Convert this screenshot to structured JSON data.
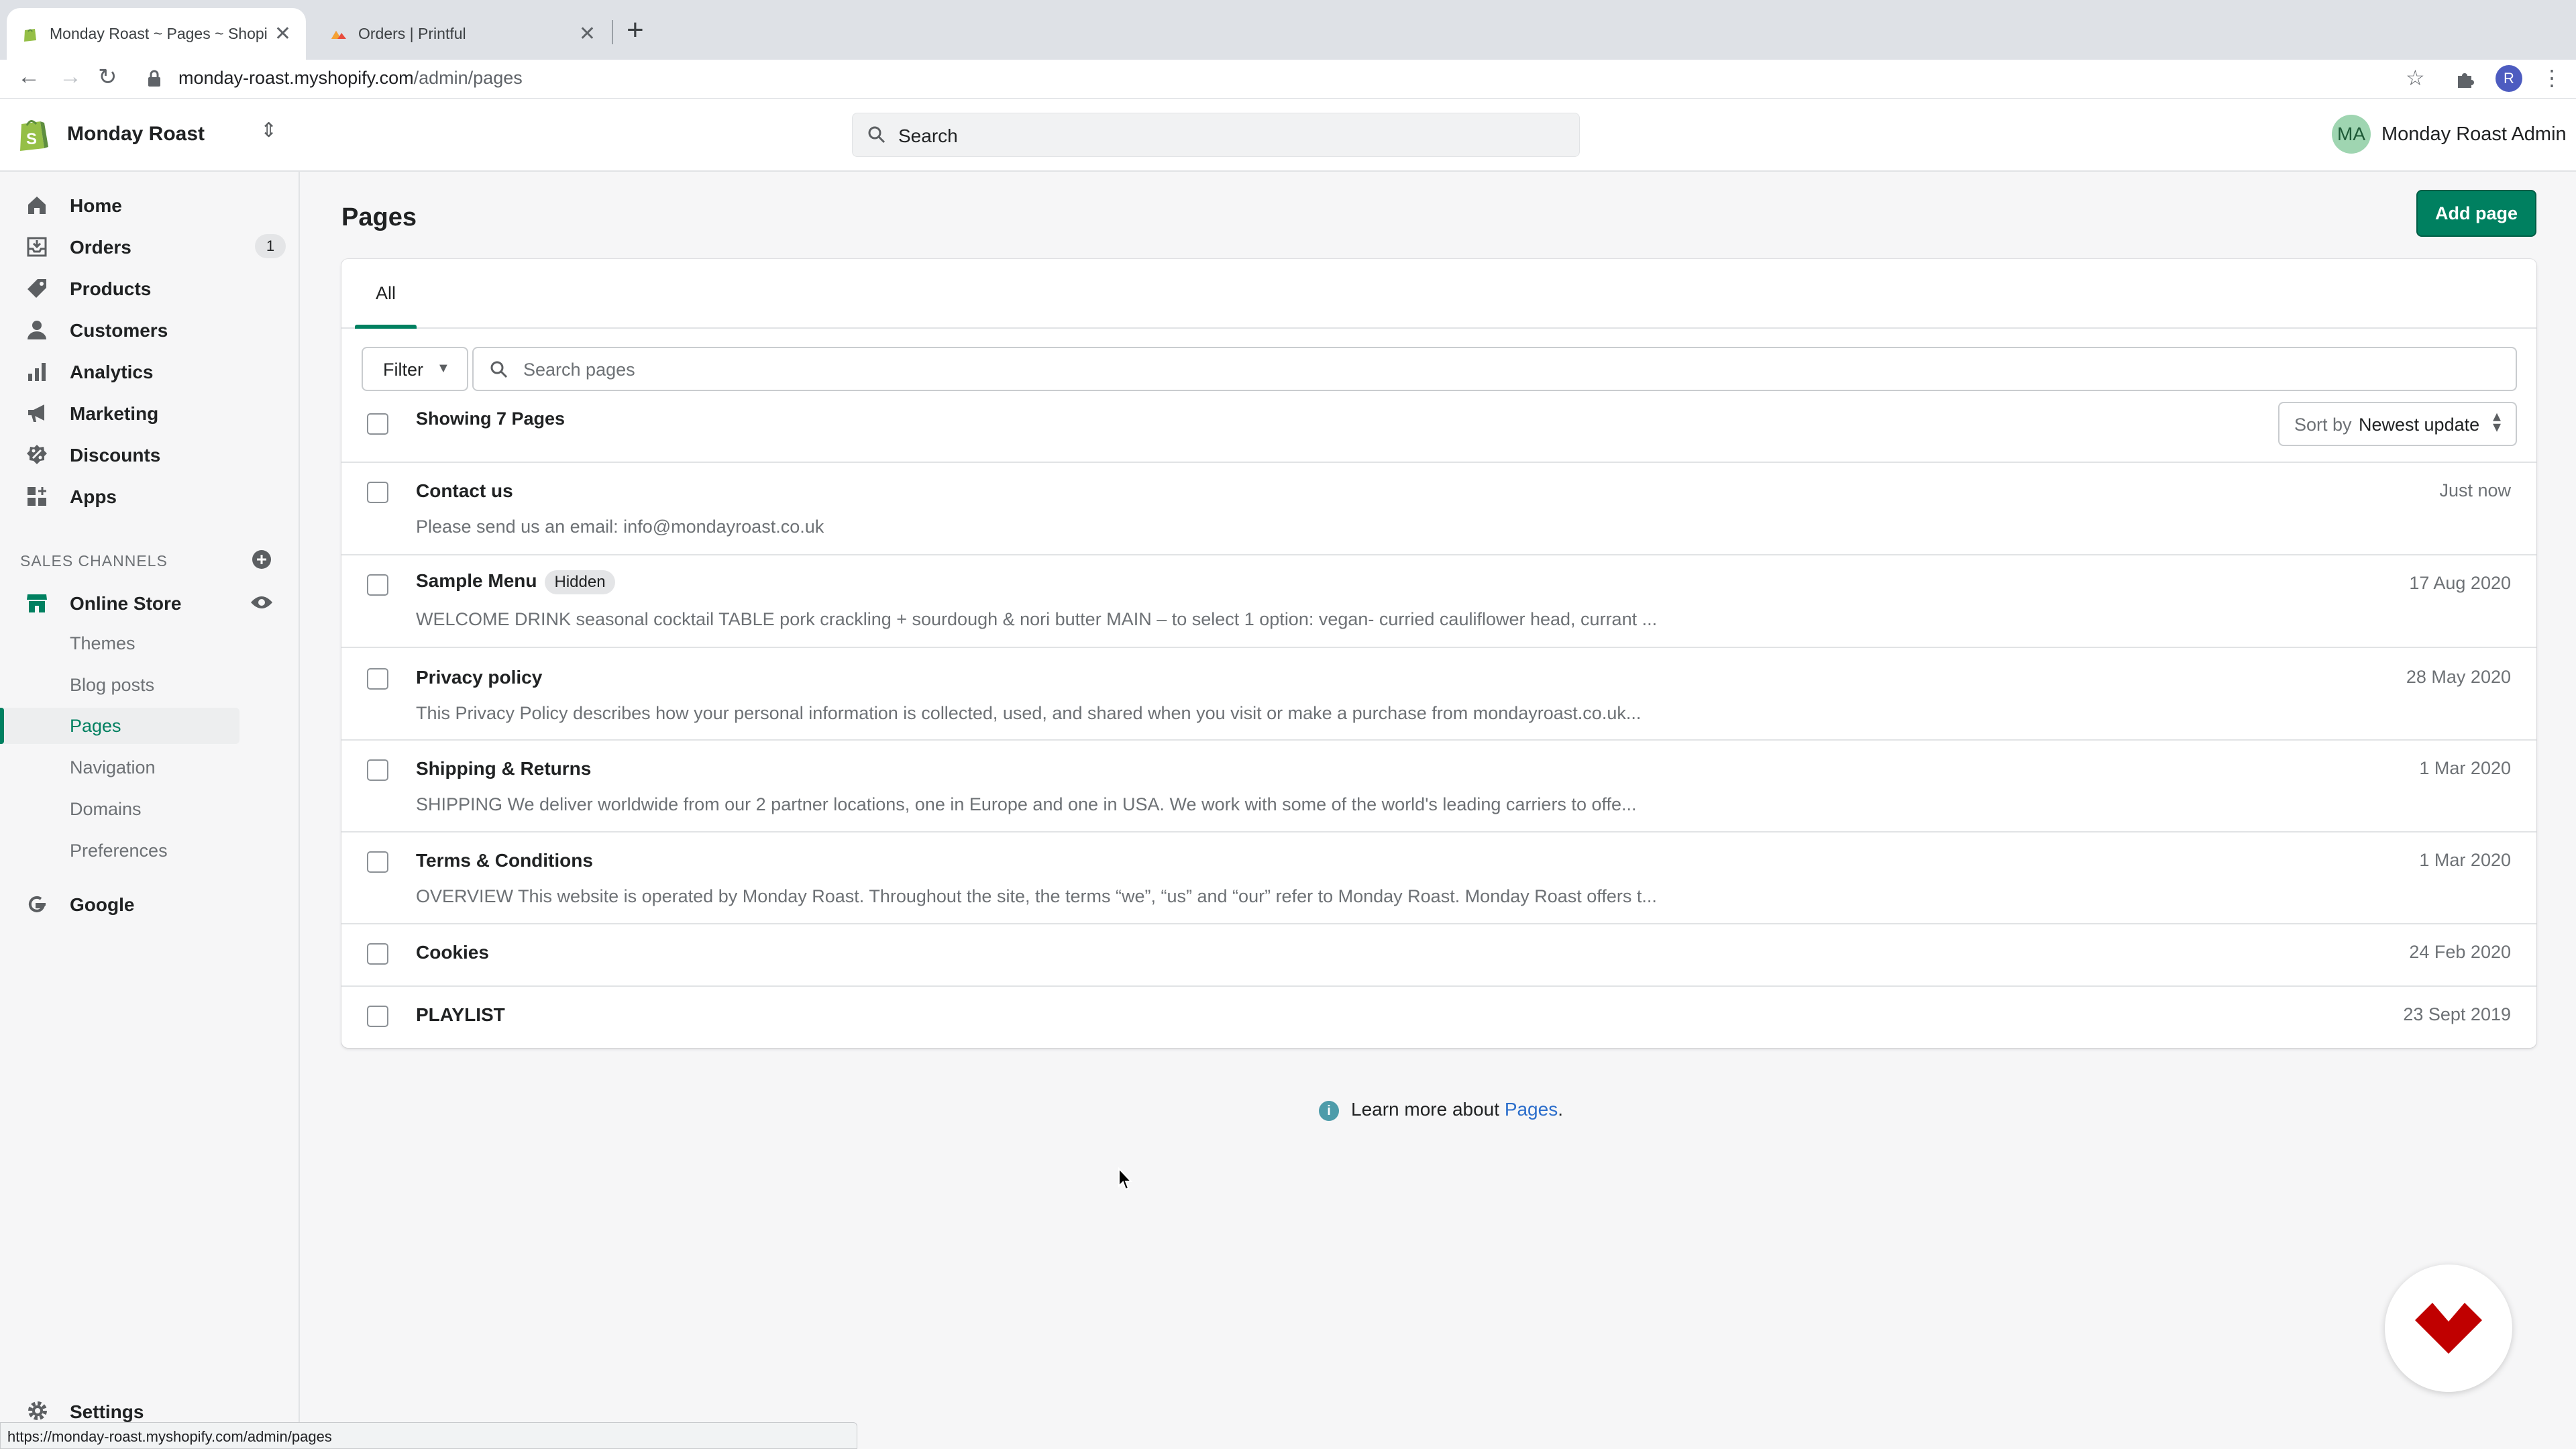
{
  "browser": {
    "tabs": [
      {
        "title": "Monday Roast ~ Pages ~ Shopify",
        "active": true
      },
      {
        "title": "Orders | Printful",
        "active": false
      }
    ],
    "url_host": "monday-roast.myshopify.com",
    "url_path": "/admin/pages",
    "profile_initial": "R",
    "status_url": "https://monday-roast.myshopify.com/admin/pages"
  },
  "topbar": {
    "store_name": "Monday Roast",
    "search_placeholder": "Search",
    "user_initials": "MA",
    "user_name": "Monday Roast Admin"
  },
  "sidebar": {
    "items": [
      {
        "label": "Home",
        "icon": "home-icon"
      },
      {
        "label": "Orders",
        "icon": "orders-icon",
        "badge": "1"
      },
      {
        "label": "Products",
        "icon": "tag-icon"
      },
      {
        "label": "Customers",
        "icon": "person-icon"
      },
      {
        "label": "Analytics",
        "icon": "bar-chart-icon"
      },
      {
        "label": "Marketing",
        "icon": "megaphone-icon"
      },
      {
        "label": "Discounts",
        "icon": "discount-icon"
      },
      {
        "label": "Apps",
        "icon": "apps-icon"
      }
    ],
    "sales_channels_label": "SALES CHANNELS",
    "online_store_label": "Online Store",
    "sub_items": [
      "Themes",
      "Blog posts",
      "Pages",
      "Navigation",
      "Domains",
      "Preferences"
    ],
    "active_sub_item": "Pages",
    "google_label": "Google",
    "settings_label": "Settings"
  },
  "main": {
    "title": "Pages",
    "add_button": "Add page",
    "tab_all": "All",
    "filter_label": "Filter",
    "search_placeholder": "Search pages",
    "showing": "Showing 7 Pages",
    "sort_label": "Sort by",
    "sort_value": "Newest update",
    "pages": [
      {
        "title": "Contact us",
        "desc": "Please send us an email: info@mondayroast.co.uk",
        "date": "Just now"
      },
      {
        "title": "Sample Menu",
        "badge": "Hidden",
        "desc": "WELCOME DRINK seasonal cocktail TABLE pork crackling + sourdough & nori butter MAIN – to select 1 option: vegan- curried cauliflower head, currant ...",
        "date": "17 Aug 2020"
      },
      {
        "title": "Privacy policy",
        "desc": "This Privacy Policy describes how your personal information is collected, used, and shared when you visit or make a purchase from mondayroast.co.uk...",
        "date": "28 May 2020"
      },
      {
        "title": "Shipping & Returns",
        "desc": "SHIPPING We deliver worldwide from our 2 partner locations, one in Europe and one in USA. We work with some of the world's leading carriers to offe...",
        "date": "1 Mar 2020"
      },
      {
        "title": "Terms & Conditions",
        "desc": "OVERVIEW This website is operated by Monday Roast. Throughout the site, the terms “we”, “us” and “our” refer to Monday Roast. Monday Roast offers t...",
        "date": "1 Mar 2020"
      },
      {
        "title": "Cookies",
        "desc": "",
        "date": "24 Feb 2020"
      },
      {
        "title": "PLAYLIST",
        "desc": "",
        "date": "23 Sept 2019"
      }
    ],
    "learn_prefix": "Learn more about ",
    "learn_link": "Pages",
    "learn_suffix": "."
  },
  "colors": {
    "accent": "#008060",
    "background": "#f6f6f7",
    "link": "#2c6ecb"
  }
}
